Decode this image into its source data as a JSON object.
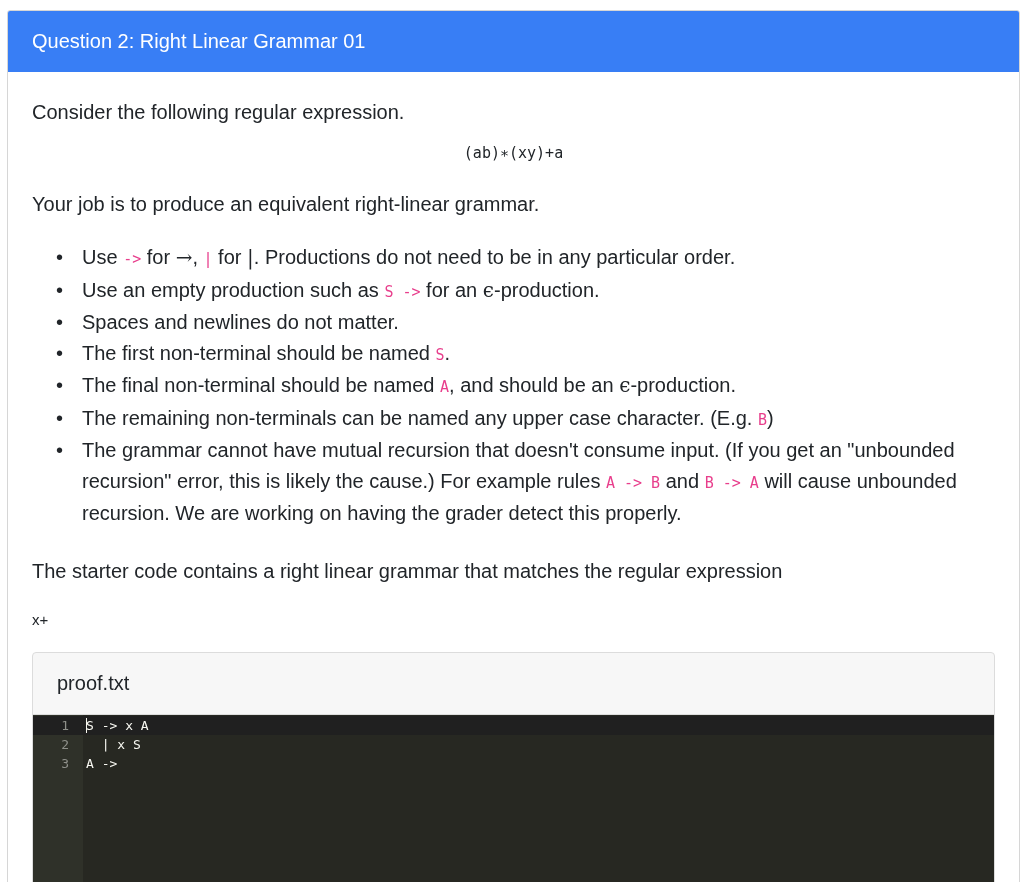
{
  "card": {
    "title": "Question 2: Right Linear Grammar 01"
  },
  "intro": "Consider the following regular expression.",
  "regex": "(ab)∗(xy)+a",
  "task": "Your job is to produce an equivalent right-linear grammar.",
  "bullet_marker": "•",
  "bullets": [
    [
      {
        "kind": "text",
        "text": "Use "
      },
      {
        "kind": "code",
        "text": "->"
      },
      {
        "kind": "text",
        "text": " for "
      },
      {
        "kind": "math",
        "text": "→"
      },
      {
        "kind": "text",
        "text": ", "
      },
      {
        "kind": "code",
        "text": "|"
      },
      {
        "kind": "text",
        "text": " for "
      },
      {
        "kind": "math",
        "text": "|"
      },
      {
        "kind": "text",
        "text": ". Productions do not need to be in any particular order."
      }
    ],
    [
      {
        "kind": "text",
        "text": "Use an empty production such as "
      },
      {
        "kind": "code",
        "text": "S ->"
      },
      {
        "kind": "text",
        "text": " for an "
      },
      {
        "kind": "math",
        "text": "ϵ"
      },
      {
        "kind": "text",
        "text": "-production."
      }
    ],
    [
      {
        "kind": "text",
        "text": "Spaces and newlines do not matter."
      }
    ],
    [
      {
        "kind": "text",
        "text": "The first non-terminal should be named "
      },
      {
        "kind": "code",
        "text": "S"
      },
      {
        "kind": "text",
        "text": "."
      }
    ],
    [
      {
        "kind": "text",
        "text": "The final non-terminal should be named "
      },
      {
        "kind": "code",
        "text": "A"
      },
      {
        "kind": "text",
        "text": ", and should be an "
      },
      {
        "kind": "math",
        "text": "ϵ"
      },
      {
        "kind": "text",
        "text": "-production."
      }
    ],
    [
      {
        "kind": "text",
        "text": "The remaining non-terminals can be named any upper case character. (E.g. "
      },
      {
        "kind": "code",
        "text": "B"
      },
      {
        "kind": "text",
        "text": ")"
      }
    ],
    [
      {
        "kind": "text",
        "text": "The grammar cannot have mutual recursion that doesn't consume input. (If you get an \"unbounded recursion\" error, this is likely the cause.) For example rules "
      },
      {
        "kind": "code",
        "text": "A -> B"
      },
      {
        "kind": "text",
        "text": " and "
      },
      {
        "kind": "code",
        "text": "B -> A"
      },
      {
        "kind": "text",
        "text": " will cause unbounded recursion. We are working on having the grader detect this properly."
      }
    ]
  ],
  "starter": "The starter code contains a right linear grammar that matches the regular expression",
  "starter_regex": "x+",
  "editor": {
    "filename": "proof.txt",
    "lines": [
      {
        "number": "1",
        "text": "S -> x A",
        "active": true
      },
      {
        "number": "2",
        "text": "  | x S",
        "active": false
      },
      {
        "number": "3",
        "text": "A ->",
        "active": false
      }
    ]
  }
}
